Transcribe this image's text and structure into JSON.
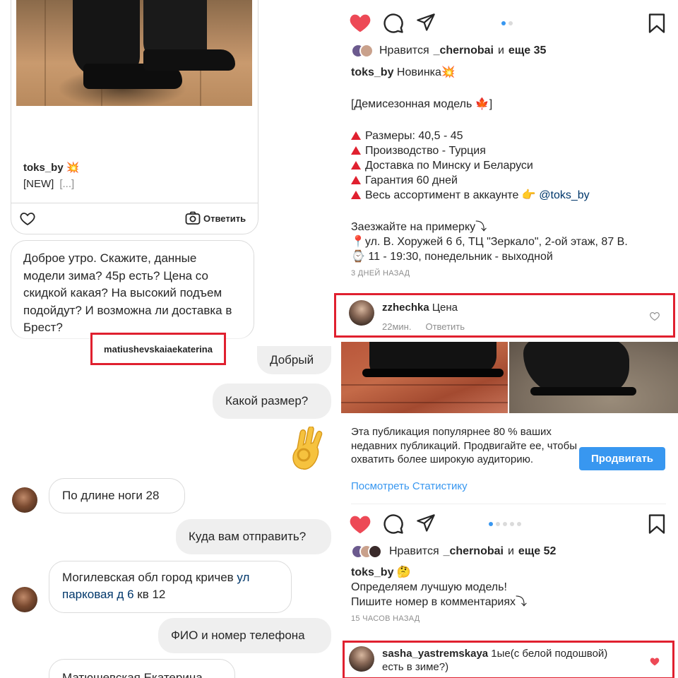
{
  "shared_post": {
    "author": "toks_by",
    "emoji": "💥",
    "text": "[NEW]",
    "more": "[...]",
    "reply_label": "Ответить"
  },
  "chat": {
    "incoming_question": "Доброе утро. Скажите, данные модели зима? 45р есть? Цена со скидкой какая? На высокий подъем подойдут? И возможна ли доставка в Брест?",
    "username_tag": "matiushevskaiaekaterina",
    "messages": [
      {
        "side": "out",
        "text": "Добрый"
      },
      {
        "side": "out",
        "text": "Какой размер?"
      },
      {
        "side": "out",
        "text": "👌"
      },
      {
        "side": "in",
        "text": "По длине ноги 28"
      },
      {
        "side": "out",
        "text": "Куда вам отправить?"
      },
      {
        "side": "in",
        "text_before": "Могилевская обл город кричев ",
        "text_link": "ул парковая д 6",
        "text_after": " кв 12"
      },
      {
        "side": "out",
        "text": "ФИО и номер телефона"
      },
      {
        "side": "in",
        "text": "Матюшевская Екатерина"
      }
    ]
  },
  "post1": {
    "likes_prefix": "Нравится",
    "likes_user": "_chernobai",
    "likes_and": "и",
    "likes_more": "еще 35",
    "author": "toks_by",
    "title": "Новинка💥",
    "season_line": "[Демисезонная модель 🍁]",
    "bullets": [
      "Размеры: 40,5 - 45",
      "Производство - Турция",
      "Доставка по Минску и Беларуси",
      "Гарантия 60 дней",
      "Весь ассортимент в аккаунте 👉"
    ],
    "mention": "@toks_by",
    "visit_line": "Заезжайте на примерку⤵",
    "address_line": "📍ул. В. Хоружей 6 б, ТЦ \"Зеркало\", 2-ой этаж, 87 В.",
    "hours_line": "⌚ 11 - 19:30, понедельник - выходной",
    "timestamp": "3 ДНЕЙ НАЗАД"
  },
  "comment1": {
    "user": "zzhechka",
    "text": "Цена",
    "time": "22мин.",
    "reply": "Ответить"
  },
  "promo": {
    "text": "Эта публикация популярнее 80 % ваших недавних публикаций. Продвигайте ее, чтобы охватить более широкую аудиторию.",
    "link": "Посмотреть Статистику",
    "button": "Продвигать"
  },
  "post2": {
    "likes_prefix": "Нравится",
    "likes_user": "_chernobai",
    "likes_and": "и",
    "likes_more": "еще 52",
    "author": "toks_by",
    "emoji": "🤔",
    "line1": "Определяем лучшую модель!",
    "line2": "Пишите номер в комментариях⤵",
    "timestamp": "15 ЧАСОВ НАЗАД"
  },
  "comment2": {
    "user": "sasha_yastremskaya",
    "text_line1": "1ые(с белой подошвой)",
    "text_line2": "есть в зиме?)"
  },
  "colors": {
    "highlight_red": "#e0202f",
    "like_red": "#ed4956",
    "link_blue": "#00376b",
    "button_blue": "#3897f0",
    "bubble_gray": "#efefef"
  }
}
